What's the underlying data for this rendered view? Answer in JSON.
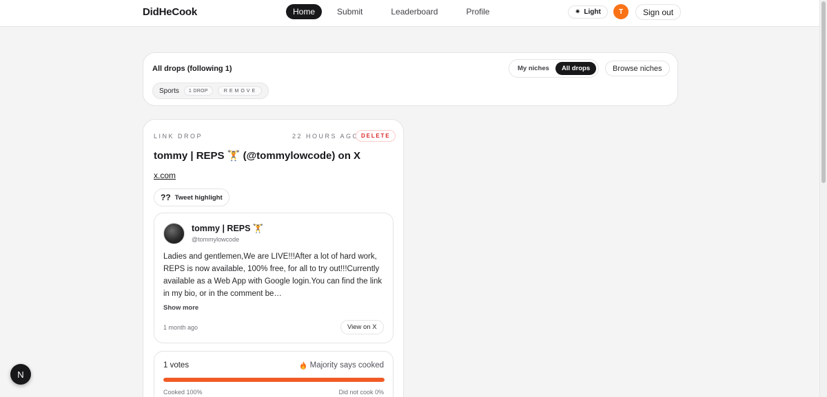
{
  "header": {
    "brand": "DidHeCook",
    "nav": [
      {
        "label": "Home",
        "active": true
      },
      {
        "label": "Submit",
        "active": false
      },
      {
        "label": "Leaderboard",
        "active": false
      },
      {
        "label": "Profile",
        "active": false
      }
    ],
    "theme_label": "Light",
    "avatar_initial": "T",
    "sign_out_label": "Sign out"
  },
  "filter": {
    "title": "All drops (following 1)",
    "segments": [
      {
        "label": "My niches",
        "active": false
      },
      {
        "label": "All drops",
        "active": true
      }
    ],
    "browse_label": "Browse niches",
    "chips": [
      {
        "label": "Sports",
        "count_label": "1 DROP",
        "remove_label": "REMOVE"
      }
    ]
  },
  "drop": {
    "type_label": "LINK DROP",
    "time_label": "22 HOURS AGO",
    "delete_label": "DELETE",
    "title": "tommy | REPS 🏋 (@tommylowcode) on X",
    "link_text": "x.com",
    "badge_icon_text": "??",
    "badge_label": "Tweet highlight",
    "tweet": {
      "author_name": "tommy | REPS 🏋",
      "author_handle": "@tommylowcode",
      "text": "Ladies and gentlemen,We are LIVE!!!After a lot of hard work, REPS is now available, 100% free, for all to try out!!!Currently available as a Web App with Google login.You can find the link in my bio, or in the comment be…",
      "show_more_label": "Show more",
      "date": "1 month ago",
      "view_label": "View on X"
    },
    "votes": {
      "count_label": "1 votes",
      "majority_label": "Majority says cooked",
      "cooked_fraction": 1.0,
      "cooked_label": "Cooked 100%",
      "not_cooked_label": "Did not cook 0%",
      "bar_color": "#f15a24"
    }
  },
  "floating": {
    "label": "N"
  },
  "colors": {
    "accent": "#18181b",
    "avatar": "#f97316",
    "danger": "#dc2626"
  }
}
